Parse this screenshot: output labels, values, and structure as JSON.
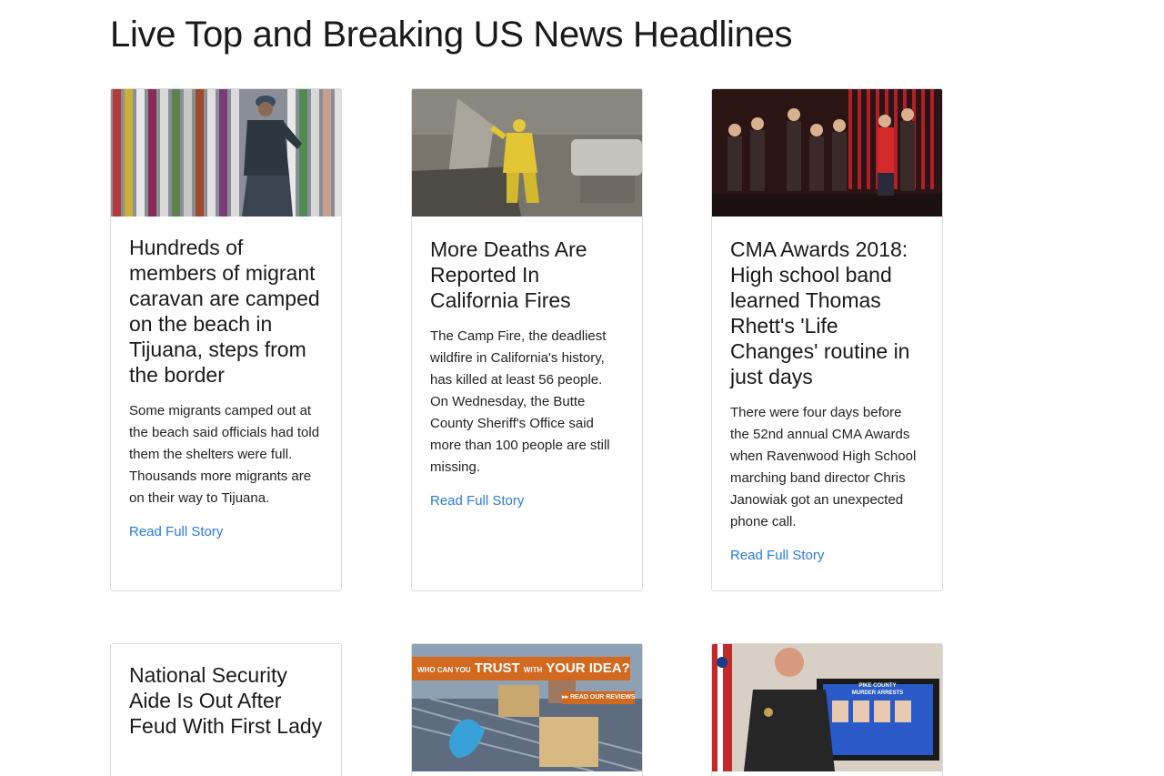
{
  "page": {
    "title": "Live Top and Breaking US News Headlines"
  },
  "colors": {
    "link": "#2b7bdc",
    "border": "#dcdcdc",
    "ad_orange": "#d2691e"
  },
  "cards": [
    {
      "image": "border-wall-soldier-photo",
      "headline": "Hundreds of members of migrant caravan are camped on the beach in Tijuana, steps from the border",
      "summary": "Some migrants camped out at the beach said officials had told them the shelters were full. Thousands more migrants are on their way to Tijuana.",
      "link": "Read Full Story"
    },
    {
      "image": "firefighter-ruins-photo",
      "headline": "More Deaths Are Reported In California Fires",
      "summary": "The Camp Fire, the deadliest wildfire in California's history, has killed at least 56 people. On Wednesday, the Butte County Sheriff's Office said more than 100 people are still missing.",
      "link": "Read Full Story"
    },
    {
      "image": "marching-band-stage-photo",
      "headline": "CMA Awards 2018: High school band learned Thomas Rhett's 'Life Changes' routine in just days",
      "summary": "There were four days before the 52nd annual CMA Awards when Ravenwood High School marching band director Chris Janowiak got an unexpected phone call.",
      "link": "Read Full Story"
    },
    {
      "headline": "National Security Aide Is Out After Feud With First Lady"
    },
    {
      "image": "advertisement-photo",
      "ad_small_1": "WHO CAN YOU",
      "ad_big_1": "TRUST",
      "ad_small_2": "WITH",
      "ad_big_2": "YOUR IDEA?",
      "ad_sub": "▸▸ READ OUR REVIEWS"
    },
    {
      "image": "sheriff-press-conference-photo",
      "screen_line_1": "PIKE COUNTY",
      "screen_line_2": "MURDER ARRESTS"
    }
  ]
}
